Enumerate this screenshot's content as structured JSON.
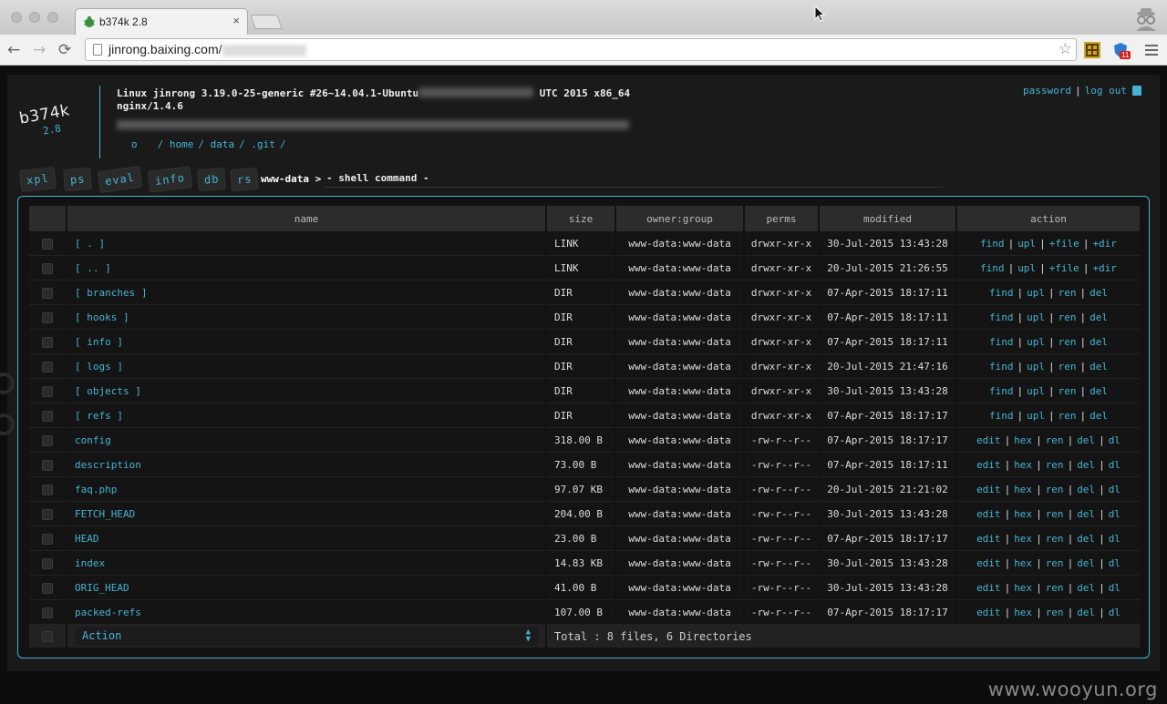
{
  "browser": {
    "tab_title": "b374k 2.8",
    "tab_close": "×",
    "url": "jinrong.baixing.com/",
    "back": "←",
    "forward": "→",
    "reload": "⟳",
    "star": "☆",
    "extension_badge": "11"
  },
  "header": {
    "password_link": "password",
    "separator": "|",
    "logout_link": "log out"
  },
  "logo": {
    "name": "b374k",
    "version": "2.8"
  },
  "sysinfo": {
    "kernel_start": "Linux jinrong 3.19.0-25-generic #26~14.04.1-Ubuntu",
    "kernel_end": "UTC 2015 x86_64",
    "server": "nginx/1.4.6"
  },
  "path": {
    "drive": "o",
    "segments": [
      "/ home",
      "/ data",
      "/ .git",
      "/"
    ]
  },
  "nav_tabs": [
    "xpl",
    "ps",
    "eval",
    "info",
    "db",
    "rs"
  ],
  "shell": {
    "prompt": "www-data >",
    "command": "- shell command -"
  },
  "table": {
    "headers": {
      "name": "name",
      "size": "size",
      "owner": "owner:group",
      "perms": "perms",
      "modified": "modified",
      "action": "action"
    },
    "rows": [
      {
        "name": "[ . ]",
        "size": "LINK",
        "owner": "www-data:www-data",
        "perms": "drwxr-xr-x",
        "modified": "30-Jul-2015 13:43:28",
        "actions": [
          "find",
          "upl",
          "+file",
          "+dir"
        ]
      },
      {
        "name": "[ .. ]",
        "size": "LINK",
        "owner": "www-data:www-data",
        "perms": "drwxr-xr-x",
        "modified": "20-Jul-2015 21:26:55",
        "actions": [
          "find",
          "upl",
          "+file",
          "+dir"
        ]
      },
      {
        "name": "[ branches ]",
        "size": "DIR",
        "owner": "www-data:www-data",
        "perms": "drwxr-xr-x",
        "modified": "07-Apr-2015 18:17:11",
        "actions": [
          "find",
          "upl",
          "ren",
          "del"
        ]
      },
      {
        "name": "[ hooks ]",
        "size": "DIR",
        "owner": "www-data:www-data",
        "perms": "drwxr-xr-x",
        "modified": "07-Apr-2015 18:17:11",
        "actions": [
          "find",
          "upl",
          "ren",
          "del"
        ]
      },
      {
        "name": "[ info ]",
        "size": "DIR",
        "owner": "www-data:www-data",
        "perms": "drwxr-xr-x",
        "modified": "07-Apr-2015 18:17:11",
        "actions": [
          "find",
          "upl",
          "ren",
          "del"
        ]
      },
      {
        "name": "[ logs ]",
        "size": "DIR",
        "owner": "www-data:www-data",
        "perms": "drwxr-xr-x",
        "modified": "20-Jul-2015 21:47:16",
        "actions": [
          "find",
          "upl",
          "ren",
          "del"
        ]
      },
      {
        "name": "[ objects ]",
        "size": "DIR",
        "owner": "www-data:www-data",
        "perms": "drwxr-xr-x",
        "modified": "30-Jul-2015 13:43:28",
        "actions": [
          "find",
          "upl",
          "ren",
          "del"
        ]
      },
      {
        "name": "[ refs ]",
        "size": "DIR",
        "owner": "www-data:www-data",
        "perms": "drwxr-xr-x",
        "modified": "07-Apr-2015 18:17:17",
        "actions": [
          "find",
          "upl",
          "ren",
          "del"
        ]
      },
      {
        "name": "config",
        "size": "318.00 B",
        "owner": "www-data:www-data",
        "perms": "-rw-r--r--",
        "modified": "07-Apr-2015 18:17:17",
        "actions": [
          "edit",
          "hex",
          "ren",
          "del",
          "dl"
        ]
      },
      {
        "name": "description",
        "size": "73.00 B",
        "owner": "www-data:www-data",
        "perms": "-rw-r--r--",
        "modified": "07-Apr-2015 18:17:11",
        "actions": [
          "edit",
          "hex",
          "ren",
          "del",
          "dl"
        ]
      },
      {
        "name": "faq.php",
        "size": "97.07 KB",
        "owner": "www-data:www-data",
        "perms": "-rw-r--r--",
        "modified": "20-Jul-2015 21:21:02",
        "actions": [
          "edit",
          "hex",
          "ren",
          "del",
          "dl"
        ]
      },
      {
        "name": "FETCH_HEAD",
        "size": "204.00 B",
        "owner": "www-data:www-data",
        "perms": "-rw-r--r--",
        "modified": "30-Jul-2015 13:43:28",
        "actions": [
          "edit",
          "hex",
          "ren",
          "del",
          "dl"
        ]
      },
      {
        "name": "HEAD",
        "size": "23.00 B",
        "owner": "www-data:www-data",
        "perms": "-rw-r--r--",
        "modified": "07-Apr-2015 18:17:17",
        "actions": [
          "edit",
          "hex",
          "ren",
          "del",
          "dl"
        ]
      },
      {
        "name": "index",
        "size": "14.83 KB",
        "owner": "www-data:www-data",
        "perms": "-rw-r--r--",
        "modified": "30-Jul-2015 13:43:28",
        "actions": [
          "edit",
          "hex",
          "ren",
          "del",
          "dl"
        ]
      },
      {
        "name": "ORIG_HEAD",
        "size": "41.00 B",
        "owner": "www-data:www-data",
        "perms": "-rw-r--r--",
        "modified": "30-Jul-2015 13:43:28",
        "actions": [
          "edit",
          "hex",
          "ren",
          "del",
          "dl"
        ]
      },
      {
        "name": "packed-refs",
        "size": "107.00 B",
        "owner": "www-data:www-data",
        "perms": "-rw-r--r--",
        "modified": "07-Apr-2015 18:17:17",
        "actions": [
          "edit",
          "hex",
          "ren",
          "del",
          "dl"
        ]
      }
    ],
    "footer": {
      "action_select": "Action",
      "total": "Total : 8 files, 6 Directories"
    }
  },
  "watermark": "www.wooyun.org",
  "colors": {
    "accent": "#46b3d2",
    "background": "#1a1a1a",
    "border": "#46b3d2"
  }
}
